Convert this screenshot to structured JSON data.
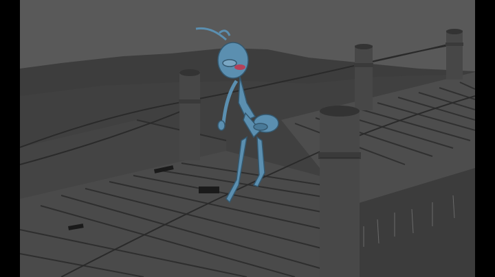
{
  "app": {
    "window_title": "",
    "panel": "3d-viewport"
  },
  "viewport": {
    "shading": "smooth-shaded",
    "background_color": "#5a5a5a",
    "ground_color": "#3e3e3e",
    "geometry_color": "#4a4a4a",
    "character_color": "#5b8fb0"
  },
  "scene": {
    "objects": [
      "ant-character",
      "wooden-dock",
      "dock-post",
      "rope-railing",
      "terrain"
    ]
  }
}
